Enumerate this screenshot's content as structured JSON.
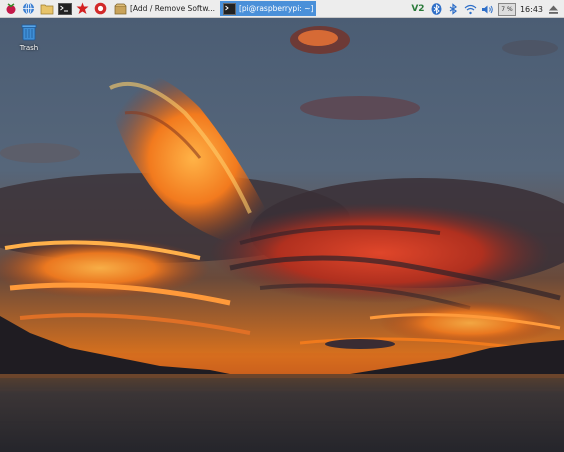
{
  "taskbar": {
    "launchers": [
      {
        "name": "raspberry-menu-icon"
      },
      {
        "name": "web-browser-icon"
      },
      {
        "name": "file-manager-icon"
      },
      {
        "name": "terminal-icon"
      },
      {
        "name": "math-kernel-icon"
      },
      {
        "name": "wolfram-icon"
      }
    ],
    "windows": [
      {
        "label": "[Add / Remove Softw...",
        "icon": "package-icon",
        "active": false
      },
      {
        "label": "[pi@raspberrypi: ~]",
        "icon": "terminal-icon",
        "active": true
      }
    ],
    "tray": {
      "vnc_label": "V2",
      "cpu_usage": "7 %",
      "clock": "16:43",
      "icons": [
        "vnc-icon",
        "bluetooth-icon",
        "bluetooth-icon",
        "wifi-icon",
        "volume-icon",
        "eject-icon"
      ]
    }
  },
  "desktop": {
    "icons": [
      {
        "label": "Trash",
        "icon": "trash-icon"
      }
    ]
  },
  "colors": {
    "active_window": "#4a90d9",
    "taskbar_bg": "#ededed",
    "sky_top": "#4a5e74",
    "cloud_orange": "#f07a1c",
    "water": "#2e2e33"
  }
}
